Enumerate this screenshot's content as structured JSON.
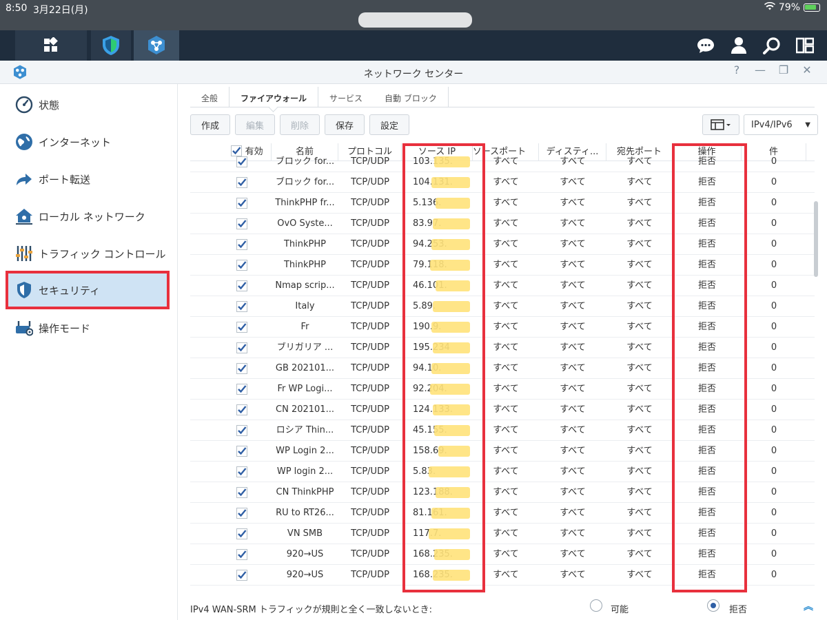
{
  "statusbar": {
    "time": "8:50",
    "date": "3月22日(月)",
    "battery": "79%"
  },
  "window": {
    "title": "ネットワーク センター"
  },
  "sidebar": {
    "items": [
      {
        "label": "状態",
        "icon": "gauge-icon"
      },
      {
        "label": "インターネット",
        "icon": "globe-icon"
      },
      {
        "label": "ポート転送",
        "icon": "arrow-forward-icon"
      },
      {
        "label": "ローカル ネットワーク",
        "icon": "home-network-icon"
      },
      {
        "label": "トラフィック コントロール",
        "icon": "sliders-icon"
      },
      {
        "label": "セキュリティ",
        "icon": "shield-icon"
      },
      {
        "label": "操作モード",
        "icon": "router-icon"
      }
    ]
  },
  "tabs": [
    "全般",
    "ファイアウォール",
    "サービス",
    "自動 ブロック"
  ],
  "toolbar": {
    "create": "作成",
    "edit": "編集",
    "delete": "削除",
    "save": "保存",
    "settings": "設定",
    "protocol_select": "IPv4/IPv6"
  },
  "table": {
    "headers": {
      "enabled": "有効",
      "name": "名前",
      "protocol": "プロトコル",
      "source_ip": "ソース IP",
      "source_port": "ソースポート",
      "destination": "ディスティ...",
      "dest_port": "宛先ポート",
      "action": "操作",
      "count": "件"
    },
    "rows": [
      {
        "name": "ブロック for...",
        "protocol": "TCP/UDP",
        "ip": "103.135.",
        "sport": "すべて",
        "dest": "すべて",
        "dport": "すべて",
        "action": "拒否",
        "count": "0"
      },
      {
        "name": "ブロック for...",
        "protocol": "TCP/UDP",
        "ip": "104.131.",
        "sport": "すべて",
        "dest": "すべて",
        "dport": "すべて",
        "action": "拒否",
        "count": "0"
      },
      {
        "name": "ThinkPHP fr...",
        "protocol": "TCP/UDP",
        "ip": "5.136.",
        "sport": "すべて",
        "dest": "すべて",
        "dport": "すべて",
        "action": "拒否",
        "count": "0"
      },
      {
        "name": "OvO Syste...",
        "protocol": "TCP/UDP",
        "ip": "83.97.",
        "sport": "すべて",
        "dest": "すべて",
        "dport": "すべて",
        "action": "拒否",
        "count": "0"
      },
      {
        "name": "ThinkPHP",
        "protocol": "TCP/UDP",
        "ip": "94.253.",
        "sport": "すべて",
        "dest": "すべて",
        "dport": "すべて",
        "action": "拒否",
        "count": "0"
      },
      {
        "name": "ThinkPHP",
        "protocol": "TCP/UDP",
        "ip": "79.118.",
        "sport": "すべて",
        "dest": "すべて",
        "dport": "すべて",
        "action": "拒否",
        "count": "0"
      },
      {
        "name": "Nmap scrip...",
        "protocol": "TCP/UDP",
        "ip": "46.101.",
        "sport": "すべて",
        "dest": "すべて",
        "dport": "すべて",
        "action": "拒否",
        "count": "0"
      },
      {
        "name": "Italy",
        "protocol": "TCP/UDP",
        "ip": "5.89.",
        "sport": "すべて",
        "dest": "すべて",
        "dport": "すべて",
        "action": "拒否",
        "count": "0"
      },
      {
        "name": "Fr",
        "protocol": "TCP/UDP",
        "ip": "190.9.",
        "sport": "すべて",
        "dest": "すべて",
        "dport": "すべて",
        "action": "拒否",
        "count": "0"
      },
      {
        "name": "ブリガリア ...",
        "protocol": "TCP/UDP",
        "ip": "195.234",
        "sport": "すべて",
        "dest": "すべて",
        "dport": "すべて",
        "action": "拒否",
        "count": "0"
      },
      {
        "name": "GB 202101...",
        "protocol": "TCP/UDP",
        "ip": "94.10.",
        "sport": "すべて",
        "dest": "すべて",
        "dport": "すべて",
        "action": "拒否",
        "count": "0"
      },
      {
        "name": "Fr WP Logi...",
        "protocol": "TCP/UDP",
        "ip": "92.204.",
        "sport": "すべて",
        "dest": "すべて",
        "dport": "すべて",
        "action": "拒否",
        "count": "0"
      },
      {
        "name": "CN 202101...",
        "protocol": "TCP/UDP",
        "ip": "124.133.",
        "sport": "すべて",
        "dest": "すべて",
        "dport": "すべて",
        "action": "拒否",
        "count": "0"
      },
      {
        "name": "ロシア Thin...",
        "protocol": "TCP/UDP",
        "ip": "45.155.",
        "sport": "すべて",
        "dest": "すべて",
        "dport": "すべて",
        "action": "拒否",
        "count": "0"
      },
      {
        "name": "WP Login 2...",
        "protocol": "TCP/UDP",
        "ip": "158.69.",
        "sport": "すべて",
        "dest": "すべて",
        "dport": "すべて",
        "action": "拒否",
        "count": "0"
      },
      {
        "name": "WP login 2...",
        "protocol": "TCP/UDP",
        "ip": "5.83.",
        "sport": "すべて",
        "dest": "すべて",
        "dport": "すべて",
        "action": "拒否",
        "count": "0"
      },
      {
        "name": "CN ThinkPHP",
        "protocol": "TCP/UDP",
        "ip": "123.188.",
        "sport": "すべて",
        "dest": "すべて",
        "dport": "すべて",
        "action": "拒否",
        "count": "0"
      },
      {
        "name": "RU to RT26...",
        "protocol": "TCP/UDP",
        "ip": "81.161.",
        "sport": "すべて",
        "dest": "すべて",
        "dport": "すべて",
        "action": "拒否",
        "count": "0"
      },
      {
        "name": "VN SMB",
        "protocol": "TCP/UDP",
        "ip": "117.7.",
        "sport": "すべて",
        "dest": "すべて",
        "dport": "すべて",
        "action": "拒否",
        "count": "0"
      },
      {
        "name": "920→US",
        "protocol": "TCP/UDP",
        "ip": "168.235.",
        "sport": "すべて",
        "dest": "すべて",
        "dport": "すべて",
        "action": "拒否",
        "count": "0"
      },
      {
        "name": "920→US",
        "protocol": "TCP/UDP",
        "ip": "168.235.",
        "sport": "すべて",
        "dest": "すべて",
        "dport": "すべて",
        "action": "拒否",
        "count": "0"
      }
    ]
  },
  "footer": {
    "label": "IPv4 WAN-SRM トラフィックが規則と全く一致しないとき:",
    "option_allow": "可能",
    "option_deny": "拒否",
    "selected": "拒否"
  },
  "colors": {
    "highlight_red": "#e8303d",
    "marker_yellow": "#ffe27a",
    "accent_blue": "#2f5fa5"
  }
}
